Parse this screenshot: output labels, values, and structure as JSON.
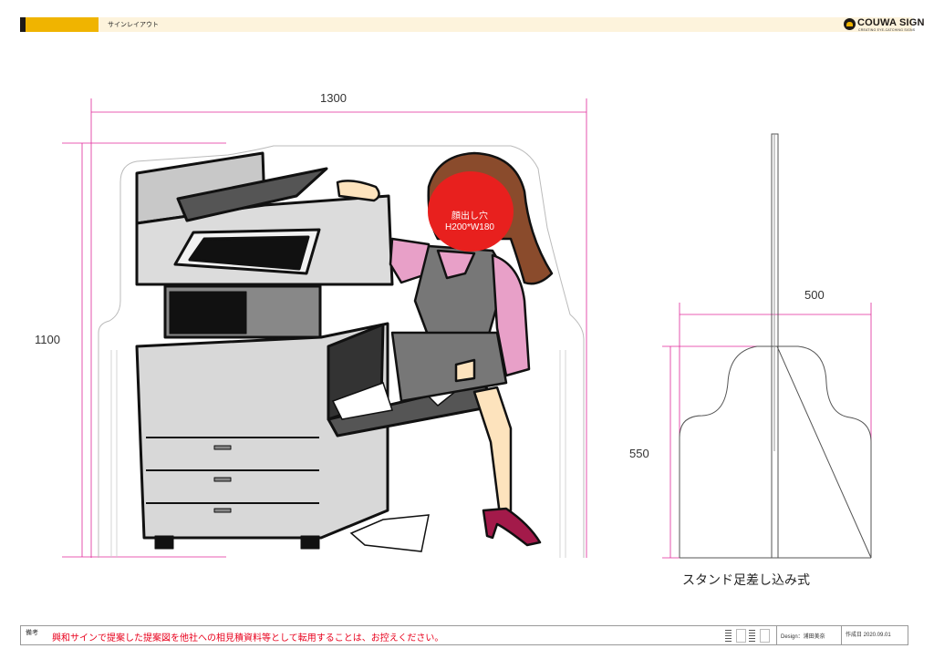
{
  "header": {
    "title": "サインレイアウト",
    "logo_text": "COUWA SIGN",
    "logo_sub": "CREATING EYE-CATCHING SIGNS"
  },
  "drawing": {
    "width_label": "1300",
    "height_label": "1100",
    "face_hole_title": "顔出し穴",
    "face_hole_size": "H200*W180",
    "stand_width_label": "500",
    "stand_height_label": "550",
    "stand_caption": "スタンド足差し込み式"
  },
  "footer": {
    "notes_label": "備考",
    "notice": "興和サインで提案した提案図を他社への相見積資料等として転用することは、お控えください。",
    "design": "Design：浦田美奈",
    "date": "作成日 2020.09.01"
  },
  "colors": {
    "dimension_line": "#e0289a",
    "face_hole": "#e8201e",
    "header_accent": "#f0b400",
    "notice_text": "#e8001c"
  }
}
